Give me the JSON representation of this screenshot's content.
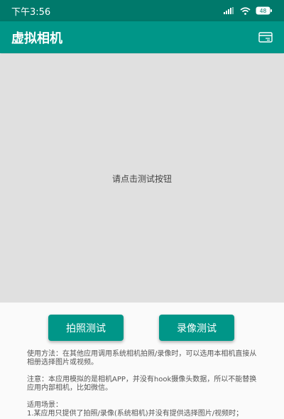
{
  "status_bar": {
    "time": "下午3:56",
    "battery": "48",
    "signal_icon": "cellular-signal-icon",
    "wifi_icon": "wifi-icon",
    "battery_icon": "battery-icon"
  },
  "app_bar": {
    "title": "虚拟相机",
    "action_icon": "card-icon"
  },
  "preview": {
    "hint": "请点击测试按钮"
  },
  "buttons": {
    "photo_label": "拍照测试",
    "video_label": "录像测试"
  },
  "instructions": {
    "usage": "使用方法：在其他应用调用系统相机拍照/录像时，可以选用本相机直接从相册选择图片或视频。",
    "note": "注意：本应用模拟的是相机APP，并没有hook摄像头数据，所以不能替换应用内部相机，比如微信。",
    "scenario_title": "适用场景：",
    "scenario_1": "1.某应用只提供了拍照/录像(系统相机)并没有提供选择图片/视频时；"
  },
  "colors": {
    "primary": "#009688",
    "primary_dark": "#00796b",
    "preview_bg": "#e0e0e0"
  }
}
